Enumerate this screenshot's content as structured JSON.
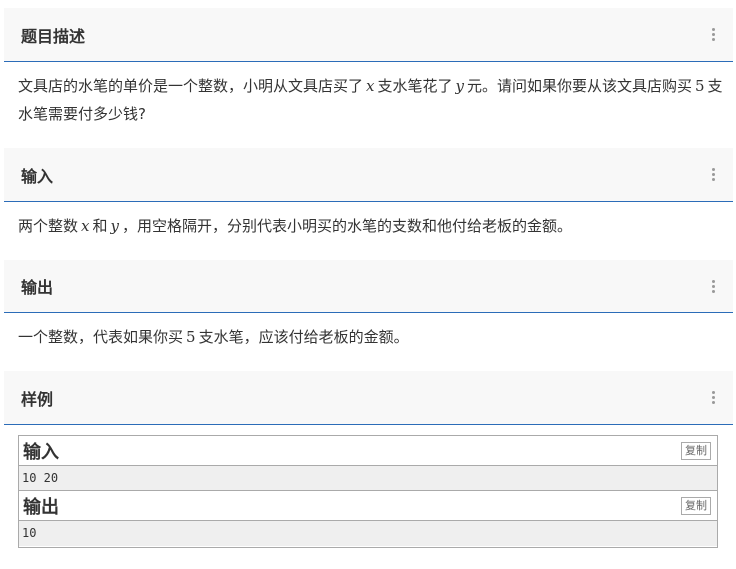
{
  "sections": {
    "description": {
      "title": "题目描述",
      "text_1": "文具店的水笔的单价是一个整数，小明从文具店买了",
      "var_x": "x",
      "text_2": "支水笔花了",
      "var_y": "y",
      "text_3": "元。请问如果你要从该文具店购买",
      "num_5": "5",
      "text_4": "支水笔需要付多少钱?"
    },
    "input": {
      "title": "输入",
      "text_1": "两个整数",
      "var_x": "x",
      "text_2": "和",
      "var_y": "y",
      "text_3": "，用空格隔开，分别代表小明买的水笔的支数和他付给老板的金额。"
    },
    "output": {
      "title": "输出",
      "text_1": "一个整数，代表如果你买",
      "num_5": "5",
      "text_2": "支水笔，应该付给老板的金额。"
    },
    "samples": {
      "title": "样例"
    }
  },
  "sample": {
    "input_label": "输入",
    "input_value": "10 20",
    "output_label": "输出",
    "output_value": "10",
    "copy_label": "复制"
  },
  "colors": {
    "header_bg": "#f8f8f8",
    "accent_line": "#2b6cb8",
    "sample_bg": "#efefef"
  }
}
